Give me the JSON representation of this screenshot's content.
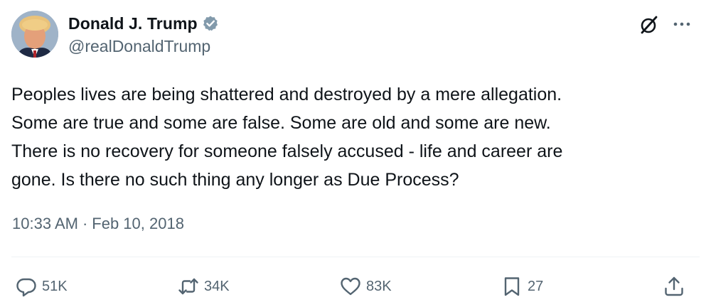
{
  "author": {
    "display_name": "Donald J. Trump",
    "handle": "@realDonaldTrump",
    "verified_color": "#829aab"
  },
  "tweet": {
    "text": "Peoples lives are being shattered and destroyed by a mere allegation.\nSome are true and some are false. Some are old and some are new.\nThere is no recovery for someone falsely accused - life and career are\ngone. Is there no such thing any longer as Due Process?",
    "time": "10:33 AM",
    "separator": "·",
    "date": "Feb 10, 2018"
  },
  "actions": {
    "replies": "51K",
    "reposts": "34K",
    "likes": "83K",
    "bookmarks": "27"
  },
  "icons": {
    "top_right": [
      "grok-icon",
      "more-icon"
    ],
    "action_bar": [
      "reply-icon",
      "repost-icon",
      "like-icon",
      "bookmark-icon",
      "share-icon"
    ]
  },
  "colors": {
    "text_primary": "#0f1419",
    "text_secondary": "#536471",
    "divider": "#eff3f4"
  }
}
